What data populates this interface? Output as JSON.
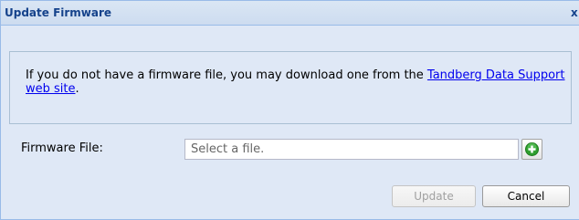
{
  "dialog": {
    "title": "Update Firmware",
    "close_label": "x"
  },
  "info": {
    "text_before": "If you do not have a firmware file, you may download one from the ",
    "link_text": "Tandberg Data Support web site",
    "text_after": "."
  },
  "form": {
    "file_label": "Firmware File:",
    "file_placeholder": "Select a file.",
    "add_icon": "plus-circle-icon"
  },
  "buttons": {
    "update_label": "Update",
    "update_enabled": false,
    "cancel_label": "Cancel"
  },
  "colors": {
    "title": "#15428b",
    "panel_bg": "#dfe8f6",
    "border": "#99bbe8",
    "link": "#0000ee",
    "add_icon": "#2e9e2e"
  }
}
